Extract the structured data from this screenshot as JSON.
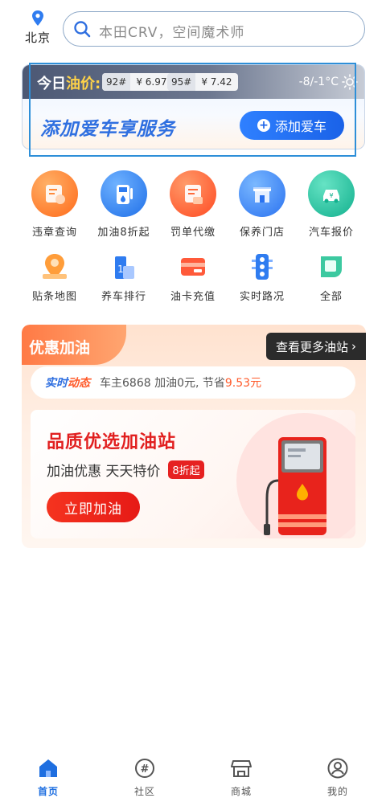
{
  "topbar": {
    "city": "北京",
    "search_placeholder": "本田CRV，空间魔术师"
  },
  "oil": {
    "today_prefix": "今日",
    "today_highlight": "油价:",
    "prices": [
      {
        "grade": "92#",
        "price": "¥ 6.97"
      },
      {
        "grade": "95#",
        "price": "¥ 7.42"
      }
    ],
    "weather_temp": "-8/-1°C",
    "add_service_text": "添加爱车享服务",
    "add_car_button": "添加爱车"
  },
  "services_main": [
    {
      "label": "违章查询",
      "icon": "violation-query-icon",
      "color": "#ff7a2a"
    },
    {
      "label": "加油8折起",
      "icon": "fuel-pump-icon",
      "color": "#2f7cf0"
    },
    {
      "label": "罚单代缴",
      "icon": "ticket-payment-icon",
      "color": "#ff5a2a"
    },
    {
      "label": "保养门店",
      "icon": "maintenance-store-icon",
      "color": "#3a86ff"
    },
    {
      "label": "汽车报价",
      "icon": "car-price-icon",
      "color": "#19c3a0"
    }
  ],
  "services_secondary": [
    {
      "label": "贴条地图",
      "icon": "map-pin-icon"
    },
    {
      "label": "养车排行",
      "icon": "ranking-icon"
    },
    {
      "label": "油卡充值",
      "icon": "fuel-card-icon"
    },
    {
      "label": "实时路况",
      "icon": "traffic-light-icon"
    },
    {
      "label": "全部",
      "icon": "all-services-icon"
    }
  ],
  "promo": {
    "tab_title": "优惠加油",
    "more_button": "查看更多油站",
    "dynamic_tag_part1": "实时",
    "dynamic_tag_part2": "动态",
    "dynamic_text": "车主6868 加油0元, 节省",
    "dynamic_saving": "9.53元",
    "headline": "品质优选加油站",
    "subline": "加油优惠 天天特价",
    "badge": "8折起",
    "cta": "立即加油"
  },
  "nav": [
    {
      "label": "首页",
      "icon": "home-icon",
      "active": true
    },
    {
      "label": "社区",
      "icon": "community-icon",
      "active": false
    },
    {
      "label": "商城",
      "icon": "store-icon",
      "active": false
    },
    {
      "label": "我的",
      "icon": "profile-icon",
      "active": false
    }
  ],
  "colors": {
    "accent_blue": "#1f6fe0",
    "accent_orange": "#ff7a45",
    "accent_red": "#e11f1f"
  }
}
